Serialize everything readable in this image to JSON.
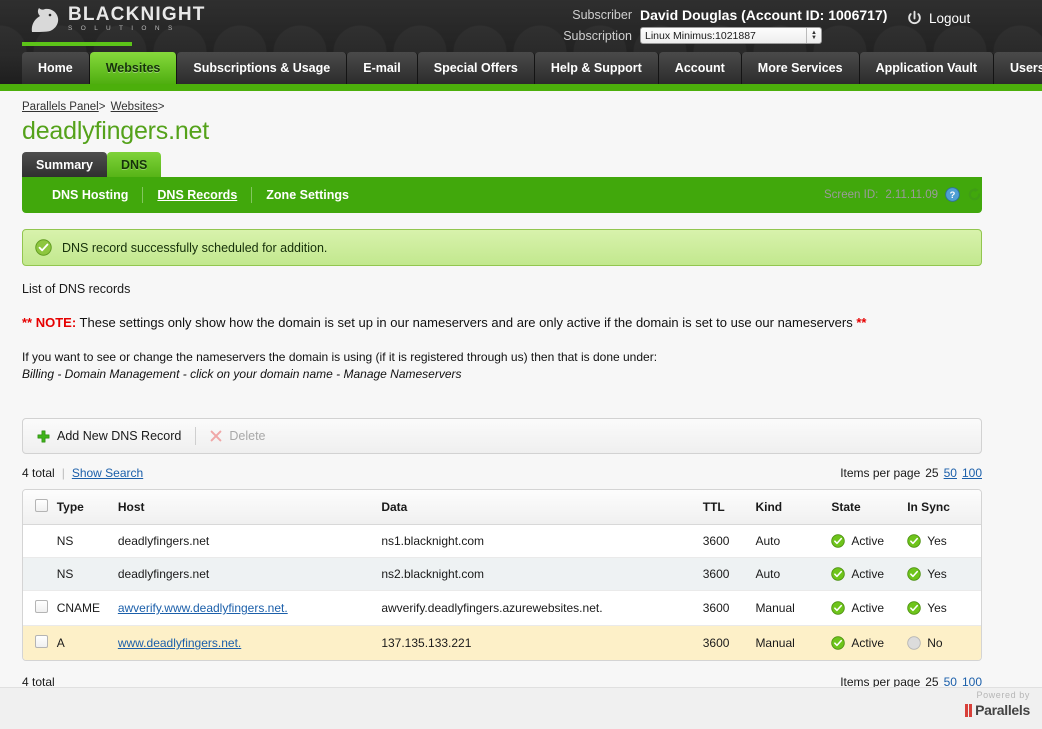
{
  "brand": {
    "logo_main": "BLACKNIGHT",
    "logo_sub": "S O L U T I O N S",
    "logo_icon": "horse-head-icon"
  },
  "header": {
    "subscriber_label": "Subscriber",
    "subscriber_value": "David Douglas (Account ID: 1006717)",
    "subscription_label": "Subscription",
    "subscription_value": "Linux Minimus:1021887",
    "logout_label": "Logout"
  },
  "mainnav": {
    "items": [
      {
        "label": "Home",
        "active": false
      },
      {
        "label": "Websites",
        "active": true
      },
      {
        "label": "Subscriptions & Usage",
        "active": false
      },
      {
        "label": "E-mail",
        "active": false
      },
      {
        "label": "Special Offers",
        "active": false
      },
      {
        "label": "Help & Support",
        "active": false
      },
      {
        "label": "Account",
        "active": false
      },
      {
        "label": "More Services",
        "active": false
      },
      {
        "label": "Application Vault",
        "active": false
      },
      {
        "label": "Users",
        "active": false
      }
    ]
  },
  "breadcrumb": {
    "items": [
      "Parallels Panel",
      "Websites"
    ],
    "separator": ">"
  },
  "screen": {
    "id_label": "Screen ID:",
    "id_value": "2.11.11.09",
    "help_icon": "help-icon",
    "refresh_icon": "refresh-icon"
  },
  "page": {
    "title": "deadlyfingers.net"
  },
  "subtabs": {
    "items": [
      {
        "label": "Summary",
        "active": false
      },
      {
        "label": "DNS",
        "active": true
      }
    ]
  },
  "subnav": {
    "items": [
      {
        "label": "DNS Hosting",
        "active": false
      },
      {
        "label": "DNS Records",
        "active": true
      },
      {
        "label": "Zone Settings",
        "active": false
      }
    ]
  },
  "banner": {
    "icon": "success-check-icon",
    "message": "DNS record successfully scheduled for addition."
  },
  "list_label": "List of DNS records",
  "note": {
    "prefix": "** NOTE:",
    "line1": " These settings only show how the domain is set up in our nameservers and are only active if the domain is set to use our nameservers ",
    "suffix": "**",
    "line2": "If you want to see or change the nameservers the domain is using (if it is registered through us) then that is done under:",
    "line3": "Billing - Domain Management - click on your domain name - Manage Nameservers"
  },
  "toolbar": {
    "add_label": "Add New DNS Record",
    "add_icon": "plus-icon",
    "delete_label": "Delete",
    "delete_icon": "x-icon"
  },
  "listinfo": {
    "total": "4 total",
    "show_search": "Show Search",
    "separator": "|",
    "items_per_page_label": "Items per page",
    "ipp_current": "25",
    "ipp_options": [
      "50",
      "100"
    ]
  },
  "table": {
    "columns": [
      "Type",
      "Host",
      "Data",
      "TTL",
      "Kind",
      "State",
      "In Sync"
    ],
    "rows": [
      {
        "checkbox": false,
        "type": "NS",
        "host": "deadlyfingers.net",
        "host_link": false,
        "data": "ns1.blacknight.com",
        "ttl": "3600",
        "kind": "Auto",
        "state": "Active",
        "state_icon": "green-check-icon",
        "sync": "Yes",
        "sync_icon": "green-check-icon",
        "style": "normal"
      },
      {
        "checkbox": false,
        "type": "NS",
        "host": "deadlyfingers.net",
        "host_link": false,
        "data": "ns2.blacknight.com",
        "ttl": "3600",
        "kind": "Auto",
        "state": "Active",
        "state_icon": "green-check-icon",
        "sync": "Yes",
        "sync_icon": "green-check-icon",
        "style": "alt"
      },
      {
        "checkbox": true,
        "type": "CNAME",
        "host": "awverify.www.deadlyfingers.net.",
        "host_link": true,
        "data": "awverify.deadlyfingers.azurewebsites.net.",
        "ttl": "3600",
        "kind": "Manual",
        "state": "Active",
        "state_icon": "green-check-icon",
        "sync": "Yes",
        "sync_icon": "green-check-icon",
        "style": "normal"
      },
      {
        "checkbox": true,
        "type": "A",
        "host": "www.deadlyfingers.net.",
        "host_link": true,
        "data": "137.135.133.221",
        "ttl": "3600",
        "kind": "Manual",
        "state": "Active",
        "state_icon": "green-check-icon",
        "sync": "No",
        "sync_icon": "gray-circle-icon",
        "style": "hl"
      }
    ]
  },
  "footer": {
    "powered_by": "Powered by",
    "vendor": "Parallels"
  },
  "colors": {
    "brand_green": "#4caf0b",
    "subnav_green": "#41a80c",
    "title_green": "#54a21a",
    "link_blue": "#1b5faa",
    "note_red": "#e60000",
    "highlight_row": "#fdf0c8"
  }
}
